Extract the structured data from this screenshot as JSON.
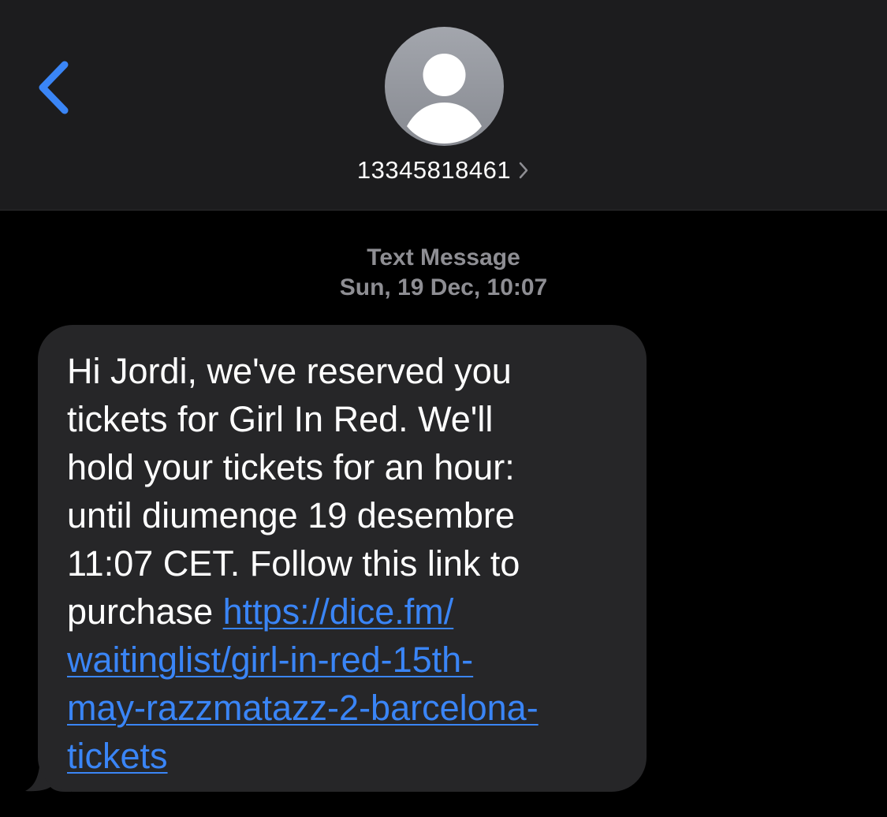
{
  "header": {
    "back_icon": "chevron-left-icon",
    "avatar_icon": "person-silhouette-icon",
    "contact_number": "13345818461",
    "contact_chevron_icon": "chevron-right-icon"
  },
  "thread": {
    "service_label": "Text Message",
    "timestamp": "Sun, 19 Dec, 10:07"
  },
  "message": {
    "text_before_link": "Hi Jordi, we've reserved you tickets for Girl In Red. We'll hold your tickets for an hour: until diumenge 19 desembre 11:07 CET. Follow this link to purchase ",
    "link_text": "https://dice.fm/waitinglist/girl-in-red-15th-may-razzmatazz-2-barcelona-tickets",
    "link_lines": [
      "https://dice.fm/",
      "waitinglist/girl-in-red-15th-",
      "may-razzmatazz-2-barcelona-",
      "tickets"
    ],
    "text_lines": [
      "Hi Jordi, we've reserved you",
      "tickets for Girl In Red. We'll",
      "hold your tickets for an hour:",
      "until diumenge 19 desembre",
      "11:07 CET. Follow this link to",
      "purchase "
    ]
  },
  "colors": {
    "background": "#000000",
    "header_background": "#1c1c1e",
    "bubble": "#262628",
    "accent_blue": "#3a85f6",
    "meta_gray": "#8e8e93"
  }
}
